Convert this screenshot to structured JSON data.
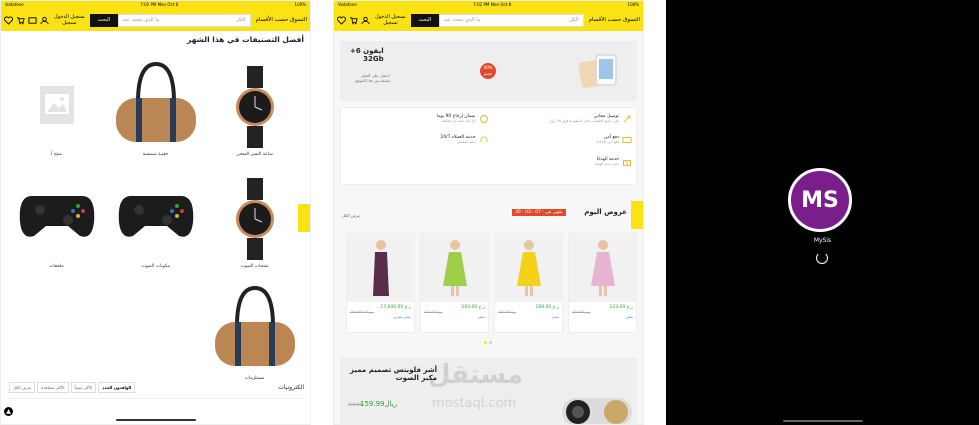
{
  "statusbar": {
    "carrier": "Vodafone",
    "time": "7:02 PM  Mon Oct 8",
    "battery": "100%"
  },
  "topbar": {
    "login_line1": "تسجيل الدخول",
    "login_line2": "تسجيل",
    "search_button": "البحث",
    "search_placeholder": "ما الذي تبحث عنه",
    "search_filter": "الكل",
    "category_menu": "التسوق حسب الأقسام"
  },
  "panel1": {
    "section_title": "أفضل التصنيفات في هذا الشهر",
    "items": [
      {
        "label": "ساعة النسر المنحى",
        "icon": "watch-icon"
      },
      {
        "label": "حقيبة شمسية",
        "icon": "duffel-bag-icon"
      },
      {
        "label": "منتج أ",
        "icon": "image-placeholder-icon"
      },
      {
        "label": "منتجات الصوت",
        "icon": "watch-icon"
      },
      {
        "label": "مكونات الصوت",
        "icon": "gamepad-icon"
      },
      {
        "label": "ملحقات",
        "icon": "gamepad-icon"
      },
      {
        "label": "مستلزمات",
        "icon": "duffel-bag-icon"
      }
    ],
    "category": {
      "name": "الكترونيات",
      "chips": [
        "الوافدون الجدد",
        "الأكثر مبيعاً",
        "الأكثر مشاهدة",
        "عرض الكل"
      ]
    }
  },
  "panel2": {
    "promo": {
      "title_line1": "ايفون 6+",
      "title_line2": "32Gb",
      "subtitle": "احصل على أفضل صفقة من هذا الموقع",
      "badge_line1": "40%",
      "badge_line2": "خصم"
    },
    "features": [
      {
        "title": "توصيل مجاني",
        "desc": "على جميع الطلبات داخل السعودية فوق 99 ريال",
        "icon": "rocket-icon"
      },
      {
        "title": "ضمان إرجاع 90 يوما",
        "desc": "إذا كان لديك أي مشكلة",
        "icon": "refresh-icon"
      },
      {
        "title": "دفع آمن",
        "desc": "دفع آمن 100%",
        "icon": "card-icon"
      },
      {
        "title": "خدمة العملاء 24/7",
        "desc": "دعم مخصص",
        "icon": "headset-icon"
      },
      {
        "title": "خدمة الهدايا",
        "desc": "دعم خدمة الهدايا",
        "icon": "gift-icon"
      }
    ],
    "deals": {
      "title": "عروض اليوم",
      "timer": "ينتهي في : 07 : 03 : 30",
      "view_all": "عرض الكل"
    },
    "products": [
      {
        "price": "ر.ع 123.00",
        "old": "ر.ع 150.00",
        "store": "متجر",
        "dress_color": "#e8b4d4"
      },
      {
        "price": "ر.ع 188.00",
        "old": "ر.ع 200.00",
        "store": "متجر",
        "dress_color": "#f4d11a"
      },
      {
        "price": "ر.ع 193.00",
        "old": "ر.ع 210.00",
        "store": "متجر",
        "dress_color": "#9fcf4a"
      },
      {
        "price": "ر.ع 17,600.00",
        "old": "ر.ع 19,000.00",
        "store": "متجر مصري",
        "dress_color": "#5a2e4a"
      }
    ],
    "speaker": {
      "title_line1": "أشر فلوبنس تصميم مميز",
      "title_line2": "مكبر الصوت",
      "price": "159.99ريال",
      "old": "200.00"
    },
    "watermark": "مستقل",
    "watermark_sub": "mostaql.com"
  },
  "panel3": {
    "logo_text": "MS",
    "app_name": "MySis"
  },
  "colors": {
    "accent": "#fbe313",
    "brand": "#7a1e8c",
    "sale": "#e04a2c",
    "price": "#2e9e3b"
  }
}
